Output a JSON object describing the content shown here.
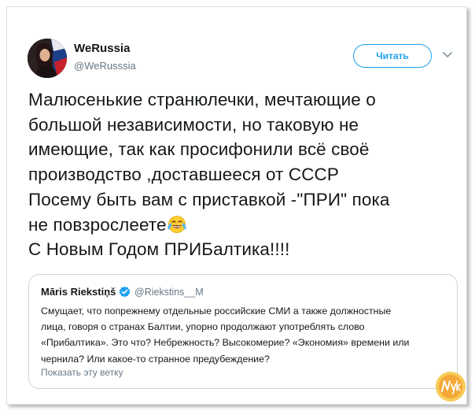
{
  "tweet": {
    "author_name": "WeRussia",
    "author_handle": "@WeRusssia",
    "follow_label": "Читать",
    "text_main": "Малюсенькие странюлечки, мечтающие о\nбольшой независимости, но таковую не\nимеющие, так как просифонили всё своё\nпроизводство ,доставшееся от СССР\nПосему быть вам с приставкой -\"ПРИ\" пока\nне повзрослеете",
    "text_tail": "С Новым Годом ПРИБалтика!!!!",
    "emoji": "face-with-tears-of-joy"
  },
  "quoted_tweet": {
    "author_name": "Māris Riekstiņš",
    "author_handle": "@Riekstins__M",
    "text": "Смущает, что попрежнему отдельные российские СМИ а также должностные\nлица, говоря о странах Балтии, упорно продолжают употреблять слово\n«Прибалтика». Это что? Небрежность? Высокомерие? «Экономия» времени или\nчернила? Или какое-то странное предубеждение?",
    "show_thread": "Показать эту ветку"
  },
  "watermark": "Nyka",
  "colors": {
    "accent": "#1da1f2",
    "text": "#14171a",
    "secondary": "#657786",
    "border": "#ccd6dd"
  }
}
